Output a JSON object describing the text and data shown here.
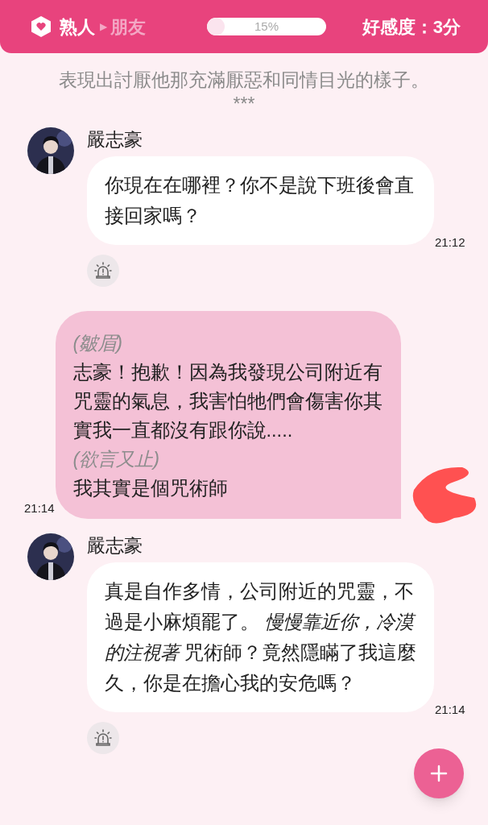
{
  "header": {
    "current_stage": "熟人",
    "arrow": "▶",
    "next_stage": "朋友",
    "progress": {
      "level": 0.15,
      "label": "15%"
    },
    "affection": "好感度：3分"
  },
  "narration": [
    "表現出討厭他那充滿厭惡和同情目光的樣子。",
    "***"
  ],
  "messages": [
    {
      "kind": "npc",
      "name": "嚴志豪",
      "text": "你現在在哪裡？你不是說下班後會直接回家嗎？",
      "time": "21:12"
    },
    {
      "kind": "player",
      "lines": [
        {
          "kind": "action",
          "text": "(皺眉)"
        },
        {
          "kind": "speech",
          "text": "志豪！抱歉！因為我發現公司附近有咒靈的氣息，我害怕牠們會傷害你其實我一直都沒有跟你說....."
        },
        {
          "kind": "action",
          "text": "(欲言又止)"
        },
        {
          "kind": "speech",
          "text": "我其實是個咒術師"
        }
      ],
      "time": "21:14"
    },
    {
      "kind": "npc",
      "name": "嚴志豪",
      "text": "真是自作多情，公司附近的咒靈，不過是小麻煩罷了。 *慢慢靠近你，冷漠的注視著* 咒術師？竟然隱瞞了我這麼久，你是在擔心我的安危嗎？",
      "time": "21:14"
    }
  ]
}
